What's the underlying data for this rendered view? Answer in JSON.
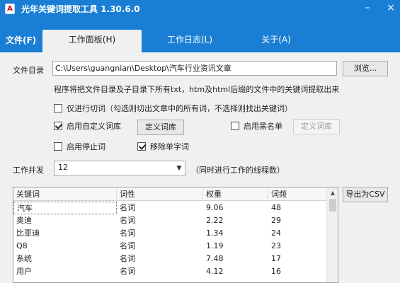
{
  "window": {
    "title": "光年关键词提取工具 1.30.6.0",
    "icon_name": "app-icon",
    "icon_glyph": "A",
    "minimize": "–",
    "close": "×"
  },
  "menu": {
    "file": "文件(F)"
  },
  "tabs": [
    {
      "label": "工作面板(H)",
      "active": true
    },
    {
      "label": "工作日志(L)",
      "active": false
    },
    {
      "label": "关于(A)",
      "active": false
    }
  ],
  "form": {
    "dir_label": "文件目录",
    "dir_value": "C:\\Users\\guangnian\\Desktop\\汽车行业资讯文章",
    "browse": "浏览...",
    "hint": "程序将把文件目录及子目录下所有txt，htm及html后缀的文件中的关键词提取出来",
    "opt_cut": "仅进行切词（勾选则切出文章中的所有词，不选择则找出关键词）",
    "opt_custom_dict": "启用自定义词库",
    "define_dict_btn": "定义词库",
    "opt_blacklist": "启用黑名单",
    "define_blacklist_btn": "定义词库",
    "opt_stopword": "启用停止词",
    "opt_remove_single": "移除单字词",
    "threads_label": "工作并发",
    "threads_value": "12",
    "threads_hint": "（同时进行工作的线程数）",
    "export_btn": "导出为CSV"
  },
  "checks": {
    "cut": false,
    "custom": true,
    "blacklist": false,
    "stopword": false,
    "single": true
  },
  "table": {
    "columns": [
      "关键词",
      "词性",
      "权重",
      "词频"
    ],
    "rows": [
      [
        "汽车",
        "名词",
        "9.06",
        "48"
      ],
      [
        "奥迪",
        "名词",
        "2.22",
        "29"
      ],
      [
        "比亚迪",
        "名词",
        "1.34",
        "24"
      ],
      [
        "Q8",
        "名词",
        "1.19",
        "23"
      ],
      [
        "系统",
        "名词",
        "7.48",
        "17"
      ],
      [
        "用户",
        "名词",
        "4.12",
        "16"
      ]
    ]
  },
  "colors": {
    "accent": "#1a7fd4"
  }
}
